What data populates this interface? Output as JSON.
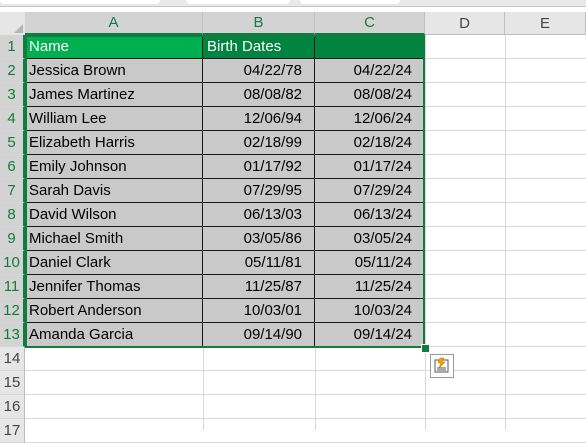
{
  "columns": [
    "A",
    "B",
    "C",
    "D",
    "E"
  ],
  "rows": [
    "1",
    "2",
    "3",
    "4",
    "5",
    "6",
    "7",
    "8",
    "9",
    "10",
    "11",
    "12",
    "13",
    "14",
    "15",
    "16",
    "17"
  ],
  "table": {
    "headers": [
      "Name",
      "Birth Dates",
      ""
    ],
    "rows": [
      [
        "Jessica Brown",
        "04/22/78",
        "04/22/24"
      ],
      [
        "James Martinez",
        "08/08/82",
        "08/08/24"
      ],
      [
        "William Lee",
        "12/06/94",
        "12/06/24"
      ],
      [
        "Elizabeth Harris",
        "02/18/99",
        "02/18/24"
      ],
      [
        "Emily Johnson",
        "01/17/92",
        "01/17/24"
      ],
      [
        "Sarah Davis",
        "07/29/95",
        "07/29/24"
      ],
      [
        "David Wilson",
        "06/13/03",
        "06/13/24"
      ],
      [
        "Michael Smith",
        "03/05/86",
        "03/05/24"
      ],
      [
        "Daniel Clark",
        "05/11/81",
        "05/11/24"
      ],
      [
        "Jennifer Thomas",
        "11/25/87",
        "11/25/24"
      ],
      [
        "Robert Anderson",
        "10/03/01",
        "10/03/24"
      ],
      [
        "Amanda Garcia",
        "09/14/90",
        "09/14/24"
      ]
    ]
  },
  "colors": {
    "accent": "#107c41",
    "header_a": "#00b050",
    "header_bc": "#00843f",
    "body_fill": "#c9c9c9"
  },
  "icons": {
    "quick_analysis": "quick-analysis-icon"
  }
}
